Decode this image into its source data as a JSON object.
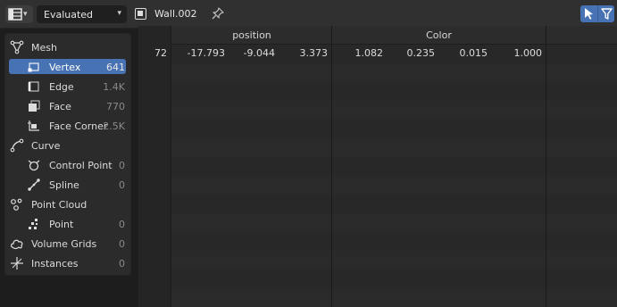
{
  "header": {
    "mode_dropdown": "Evaluated",
    "object_name": "Wall.002"
  },
  "sidebar": {
    "items": [
      {
        "label": "Mesh",
        "count": ""
      },
      {
        "label": "Vertex",
        "count": "641"
      },
      {
        "label": "Edge",
        "count": "1.4K"
      },
      {
        "label": "Face",
        "count": "770"
      },
      {
        "label": "Face Corner",
        "count": "2.5K"
      },
      {
        "label": "Curve",
        "count": ""
      },
      {
        "label": "Control Point",
        "count": "0"
      },
      {
        "label": "Spline",
        "count": "0"
      },
      {
        "label": "Point Cloud",
        "count": ""
      },
      {
        "label": "Point",
        "count": "0"
      },
      {
        "label": "Volume Grids",
        "count": "0"
      },
      {
        "label": "Instances",
        "count": "0"
      }
    ]
  },
  "table": {
    "columns": [
      "position",
      "Color"
    ],
    "row": {
      "index": "72",
      "position": [
        "-17.793",
        "-9.044",
        "3.373"
      ],
      "color": [
        "1.082",
        "0.235",
        "0.015",
        "1.000"
      ]
    }
  }
}
